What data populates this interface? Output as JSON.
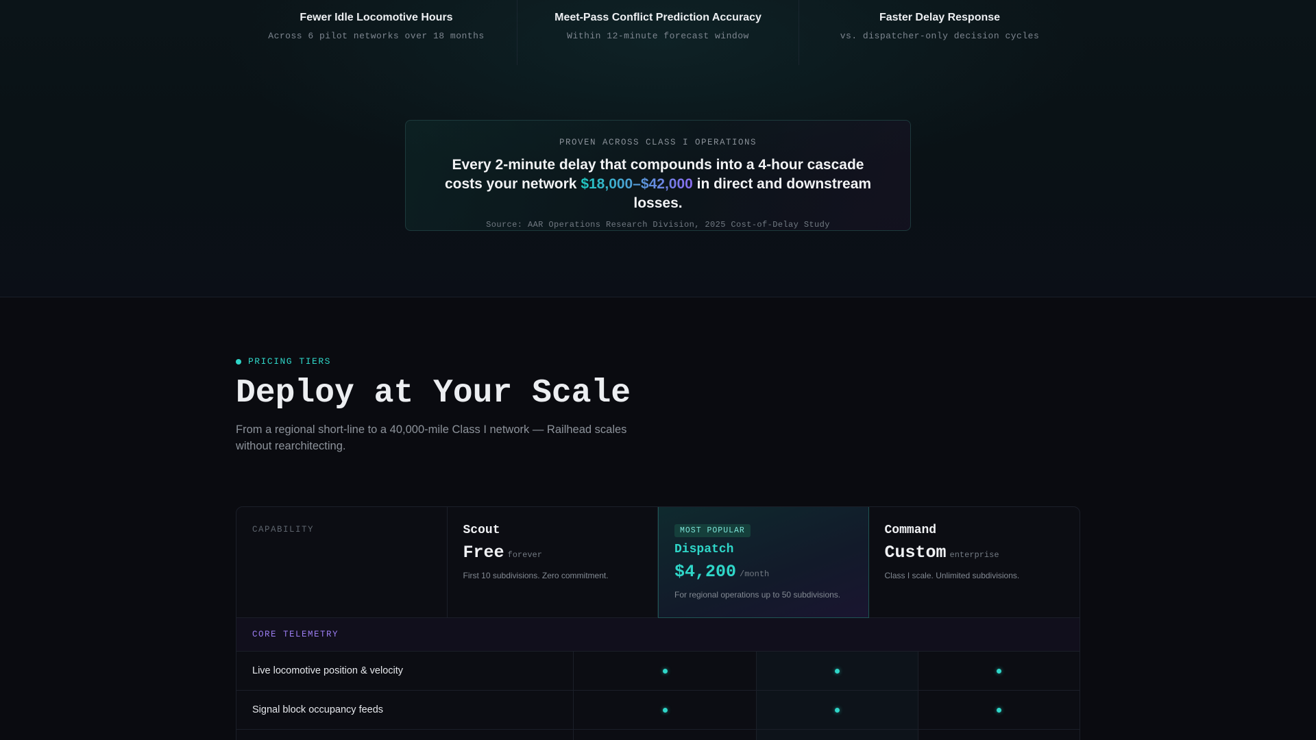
{
  "stats": [
    {
      "title": "Fewer Idle Locomotive Hours",
      "sub": "Across 6 pilot networks over 18 months"
    },
    {
      "title": "Meet-Pass Conflict Prediction Accuracy",
      "sub": "Within 12-minute forecast window"
    },
    {
      "title": "Faster Delay Response",
      "sub": "vs. dispatcher-only decision cycles"
    }
  ],
  "proof": {
    "eyebrow": "PROVEN ACROSS CLASS I OPERATIONS",
    "text_before": "Every 2-minute delay that compounds into a 4-hour cascade costs your network ",
    "highlight": "$18,000–$42,000",
    "text_after": " in direct and downstream losses.",
    "source": "Source: AAR Operations Research Division, 2025 Cost-of-Delay Study"
  },
  "pricing": {
    "eyebrow": "PRICING TIERS",
    "heading": "Deploy at Your Scale",
    "lede": "From a regional short-line to a 40,000-mile Class I network — Railhead scales without rearchitecting.",
    "capability_label": "CAPABILITY",
    "tiers": [
      {
        "name": "Scout",
        "price": "Free",
        "unit": "forever",
        "desc": "First 10 subdivisions. Zero commitment."
      },
      {
        "badge": "MOST POPULAR",
        "name": "Dispatch",
        "price": "$4,200",
        "unit": "/month",
        "desc": "For regional operations up to 50 subdivisions."
      },
      {
        "name": "Command",
        "price": "Custom",
        "unit": "enterprise",
        "desc": "Class I scale. Unlimited subdivisions."
      }
    ],
    "section": "CORE TELEMETRY",
    "features": [
      {
        "label": "Live locomotive position & velocity"
      },
      {
        "label": "Signal block occupancy feeds"
      }
    ]
  },
  "colors": {
    "accent": "#2fd6c8",
    "violet": "#9a7cf0",
    "background": "#0a0b10"
  }
}
